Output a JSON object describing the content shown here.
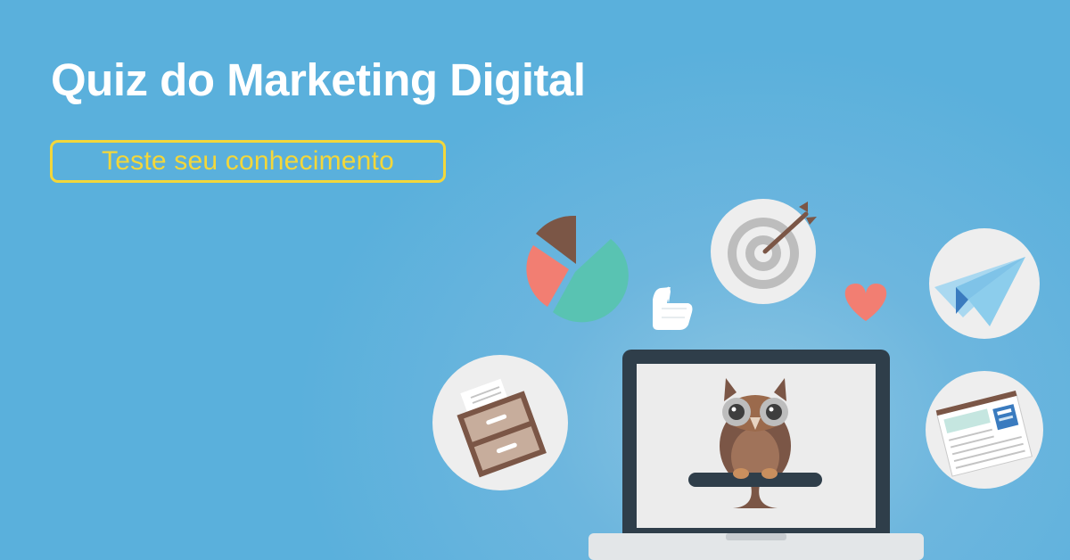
{
  "banner": {
    "title": "Quiz do Marketing Digital",
    "subtitle": "Teste seu conhecimento"
  },
  "colors": {
    "background": "#5ab0dc",
    "title": "#ffffff",
    "accent": "#f3d73a",
    "owl_brown": "#9b6a4c",
    "laptop_frame": "#2f3e4a"
  },
  "illustrations": [
    "pie-chart-icon",
    "thumbs-up-icon",
    "target-icon",
    "heart-icon",
    "paper-plane-icon",
    "file-cabinet-icon",
    "laptop-icon",
    "owl-icon",
    "newspaper-icon"
  ]
}
